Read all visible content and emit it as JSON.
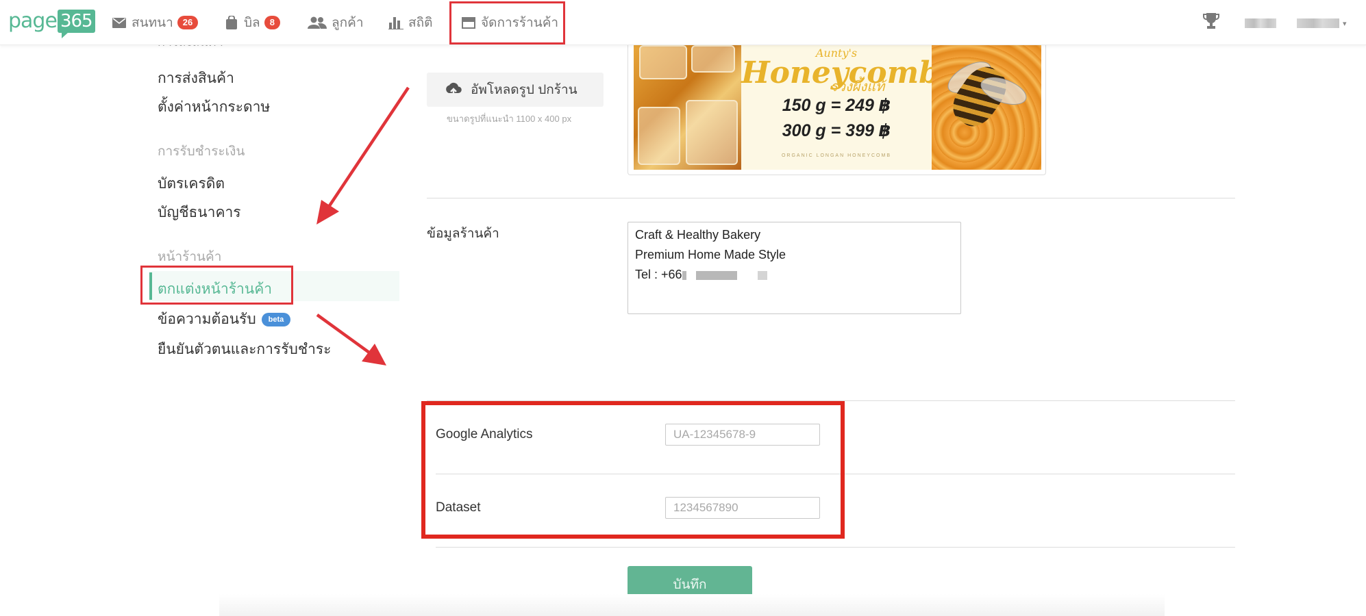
{
  "navbar": {
    "logo_text": "page",
    "logo_box": "365",
    "items": [
      {
        "label": "สนทนา",
        "badge": "26",
        "icon": "envelope-icon"
      },
      {
        "label": "บิล",
        "badge": "8",
        "icon": "bag-icon"
      },
      {
        "label": "ลูกค้า",
        "badge": "",
        "icon": "users-icon"
      },
      {
        "label": "สถิติ",
        "badge": "",
        "icon": "bar-chart-icon"
      },
      {
        "label": "จัดการร้านค้า",
        "badge": "",
        "icon": "store-icon"
      }
    ],
    "trophy_icon": "trophy-icon",
    "user_caret": "▾"
  },
  "sidebar": {
    "partial_heading": "การส่งสินค้า",
    "shipping_link": "การส่งสินค้า",
    "page_setup_link": "ตั้งค่าหน้ากระดาษ",
    "payment_heading": "การรับชำระเงิน",
    "credit_card_link": "บัตรเครดิต",
    "bank_account_link": "บัญชีธนาคาร",
    "storefront_heading": "หน้าร้านค้า",
    "decorate_link": "ตกแต่งหน้าร้านค้า",
    "welcome_message_link": "ข้อความต้อนรับ",
    "beta_badge": "beta",
    "verify_link": "ยืนยันตัวตนและการรับชำระ"
  },
  "main": {
    "upload_button": "อัพโหลดรูป ปกร้าน",
    "upload_hint": "ขนาดรูปที่แนะนำ 1100 x 400 px",
    "banner": {
      "brand": "Aunty's",
      "title": "Honeycomb",
      "thai": "รวงผึ้งแท้",
      "price1": "150 g = 249 ฿",
      "price2": "300 g = 399 ฿",
      "organic": "ORGANIC LONGAN HONEYCOMB"
    },
    "store_info_label": "ข้อมูลร้านค้า",
    "store_info_line1": "Craft & Healthy Bakery",
    "store_info_line2": "Premium Home Made Style",
    "store_info_tel": "Tel : +66",
    "ga_label": "Google Analytics",
    "ga_placeholder": "UA-12345678-9",
    "dataset_label": "Dataset",
    "dataset_placeholder": "1234567890",
    "save_button": "บันทึก"
  },
  "colors": {
    "brand_green": "#57b894",
    "annotation_red": "#e0343a",
    "badge_red": "#e74c3c",
    "beta_blue": "#4a90d9"
  }
}
